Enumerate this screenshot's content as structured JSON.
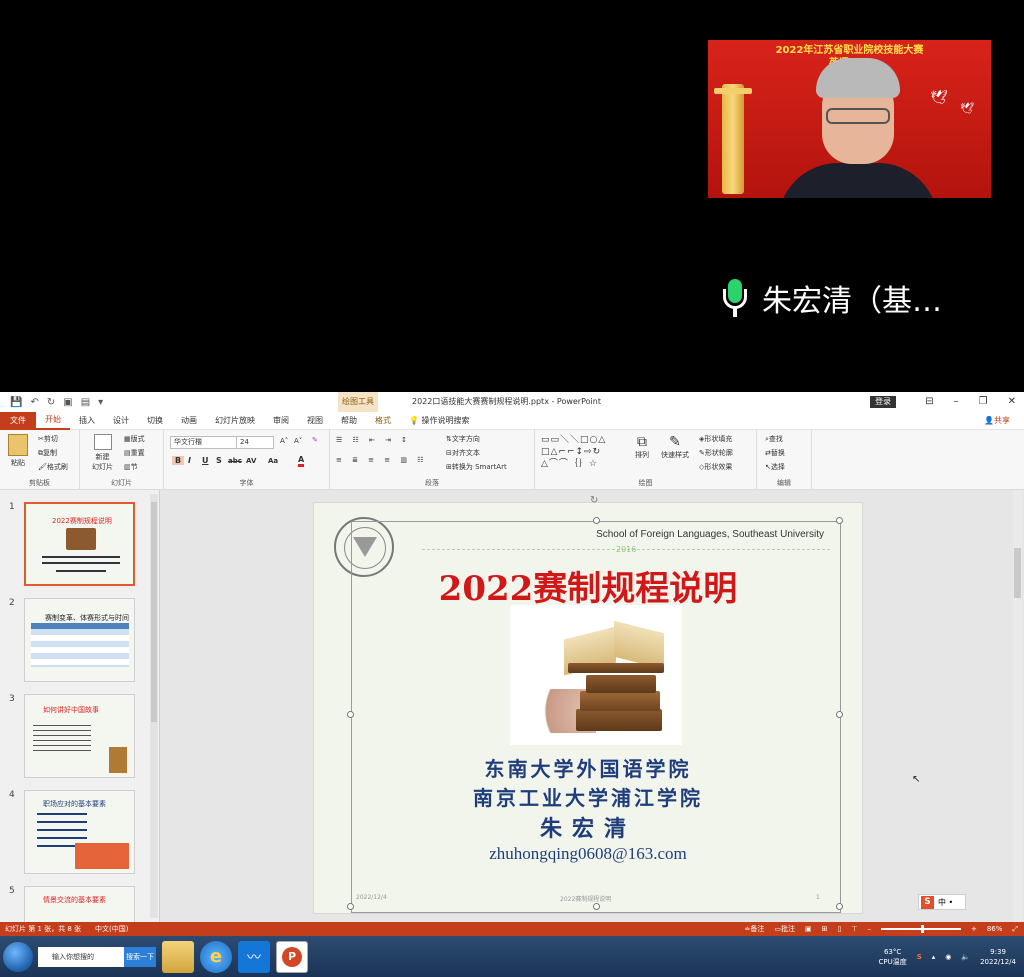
{
  "video_call": {
    "banner_line1": "2022年江苏省职业院校技能大赛",
    "banner_line2": "英语口...",
    "speaker_name": "朱宏清（基…"
  },
  "window": {
    "title": "2022口语技能大赛赛制规程说明.pptx  -  PowerPoint",
    "context_tab": "绘图工具",
    "login_label": "登录"
  },
  "ribbon_tabs": [
    "文件",
    "开始",
    "插入",
    "设计",
    "切换",
    "动画",
    "幻灯片放映",
    "审阅",
    "视图",
    "帮助",
    "格式"
  ],
  "search_tell": "操作说明搜索",
  "share_label": "共享",
  "ribbon": {
    "clipboard": {
      "paste": "粘贴",
      "cut": "剪切",
      "copy": "复制",
      "format_painter": "格式刷",
      "label": "剪贴板"
    },
    "slides": {
      "new_slide": "新建",
      "new_slide2": "幻灯片",
      "layout": "版式",
      "reset": "重置",
      "section": "节",
      "label": "幻灯片"
    },
    "font": {
      "name": "华文行楷",
      "size": "24",
      "label": "字体"
    },
    "paragraph": {
      "text_direction": "文字方向",
      "align_text": "对齐文本",
      "smartart": "转换为 SmartArt",
      "label": "段落"
    },
    "drawing": {
      "arrange": "排列",
      "quick_styles": "快速样式",
      "shape_fill": "形状填充",
      "shape_outline": "形状轮廓",
      "shape_effects": "形状效果",
      "label": "绘图"
    },
    "editing": {
      "find": "查找",
      "replace": "替换",
      "select": "选择",
      "label": "编辑"
    }
  },
  "thumbnails": [
    {
      "num": "1",
      "title": "2022赛制规程说明"
    },
    {
      "num": "2",
      "title": "赛制变革、体赛形式与时间分配"
    },
    {
      "num": "3",
      "title": "如何讲好中国故事"
    },
    {
      "num": "4",
      "title": "职场应对的基本要素"
    },
    {
      "num": "5",
      "title": "情景交流的基本要素"
    }
  ],
  "slide": {
    "school_en": "School of Foreign Languages, Southeast University",
    "year": "2016",
    "title": "2022赛制规程说明",
    "college1": "东南大学外国语学院",
    "college2": "南京工业大学浦江学院",
    "author": "朱宏清",
    "email": "zhuhongqing0608@163.com",
    "footer_date": "2022/12/4",
    "footer_title": "2022赛制规程说明",
    "footer_page": "1"
  },
  "status_bar": {
    "slide_info": "幻灯片 第 1 张，共 8 张",
    "language": "中文(中国)",
    "notes": "备注",
    "comments": "批注",
    "zoom": "86%"
  },
  "taskbar": {
    "search_placeholder": "输入你想搜的",
    "search_button": "搜索一下",
    "cpu_temp": "63°C",
    "cpu_label": "CPU温度",
    "time": "9:39",
    "date": "2022/12/4"
  },
  "colors": {
    "ppt_accent": "#c43e1c",
    "slide_title": "#d11818",
    "slide_text": "#1f3d7a",
    "mic_green": "#2bd46a"
  }
}
